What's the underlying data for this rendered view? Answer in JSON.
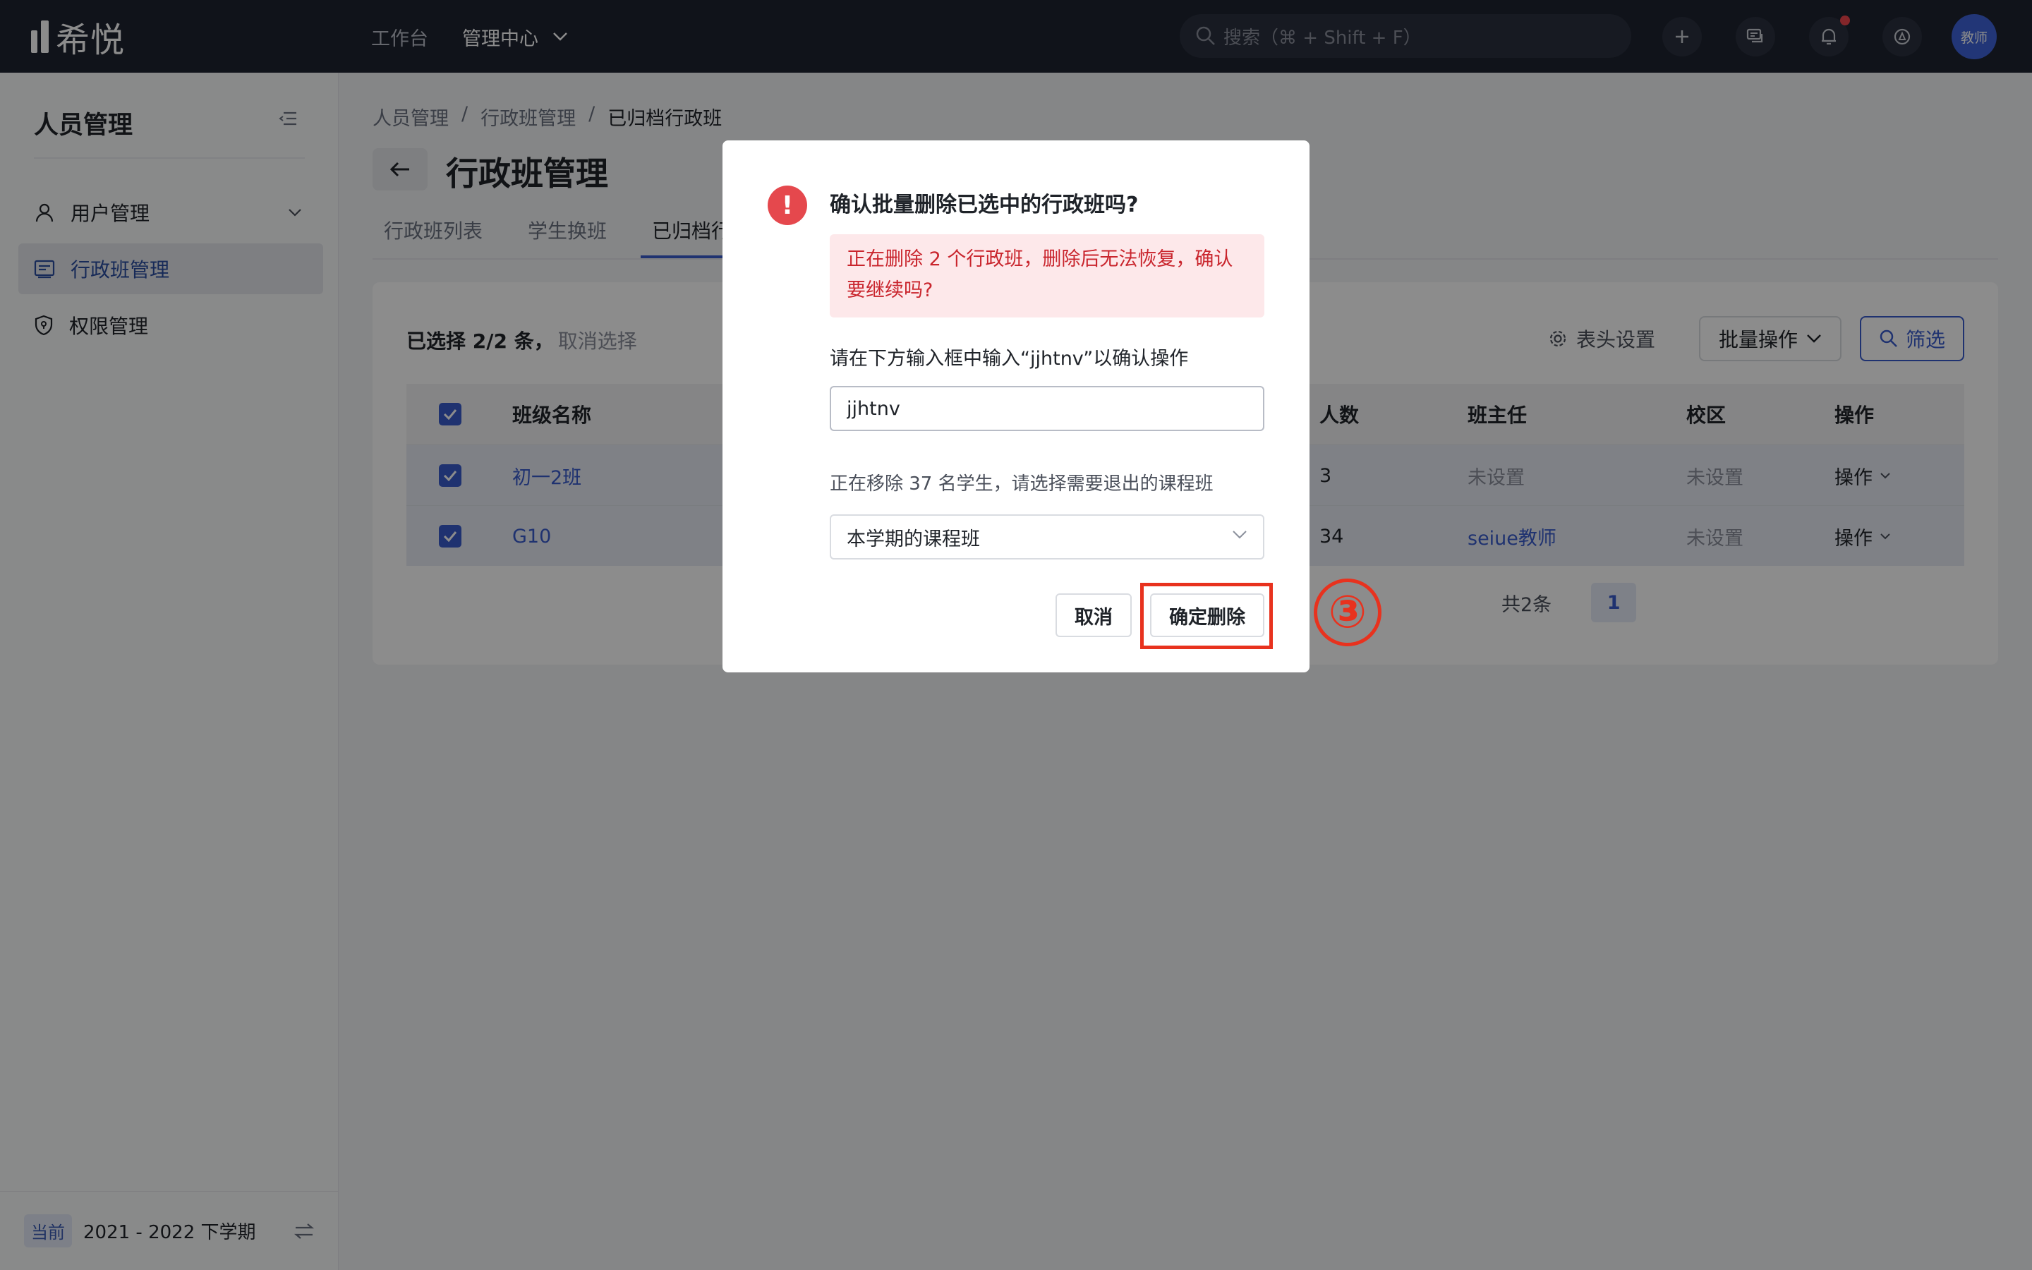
{
  "topbar": {
    "logo_text": "希悦",
    "nav_workbench": "工作台",
    "nav_admin": "管理中心",
    "search_placeholder": "搜索（⌘ + Shift + F）",
    "avatar_text": "教师"
  },
  "sidebar": {
    "title": "人员管理",
    "items": [
      {
        "label": "用户管理",
        "icon": "user-icon"
      },
      {
        "label": "行政班管理",
        "icon": "class-list-icon"
      },
      {
        "label": "权限管理",
        "icon": "shield-icon"
      }
    ],
    "footer_badge": "当前",
    "footer_term": "2021 - 2022 下学期"
  },
  "main": {
    "breadcrumb": [
      "人员管理",
      "/",
      "行政班管理",
      "/",
      "已归档行政班"
    ],
    "page_title": "行政班管理",
    "tabs": [
      "行政班列表",
      "学生换班",
      "已归档行"
    ],
    "selection_text": "已选择 2/2 条，",
    "cancel_selection": "取消选择",
    "column_settings": "表头设置",
    "bulk_action": "批量操作",
    "filter": "筛选",
    "table": {
      "headers": [
        "班级名称",
        "人数",
        "班主任",
        "校区",
        "操作"
      ],
      "rows": [
        {
          "name": "初一2班",
          "count": "3",
          "teacher": "未设置",
          "campus": "未设置",
          "action": "操作"
        },
        {
          "name": "G10",
          "count": "34",
          "teacher": "seiue教师",
          "campus": "未设置",
          "action": "操作"
        }
      ]
    },
    "total": "共2条",
    "page": "1"
  },
  "modal": {
    "title": "确认批量删除已选中的行政班吗?",
    "alert": "正在删除 2 个行政班，删除后无法恢复，确认要继续吗?",
    "hint": "请在下方输入框中输入“jjhtnv”以确认操作",
    "input_value": "jjhtnv",
    "sub_text": "正在移除 37 名学生，请选择需要退出的课程班",
    "select_value": "本学期的课程班",
    "cancel": "取消",
    "confirm": "确定删除"
  },
  "annotation": {
    "step": "③",
    "color": "#e8321e"
  }
}
